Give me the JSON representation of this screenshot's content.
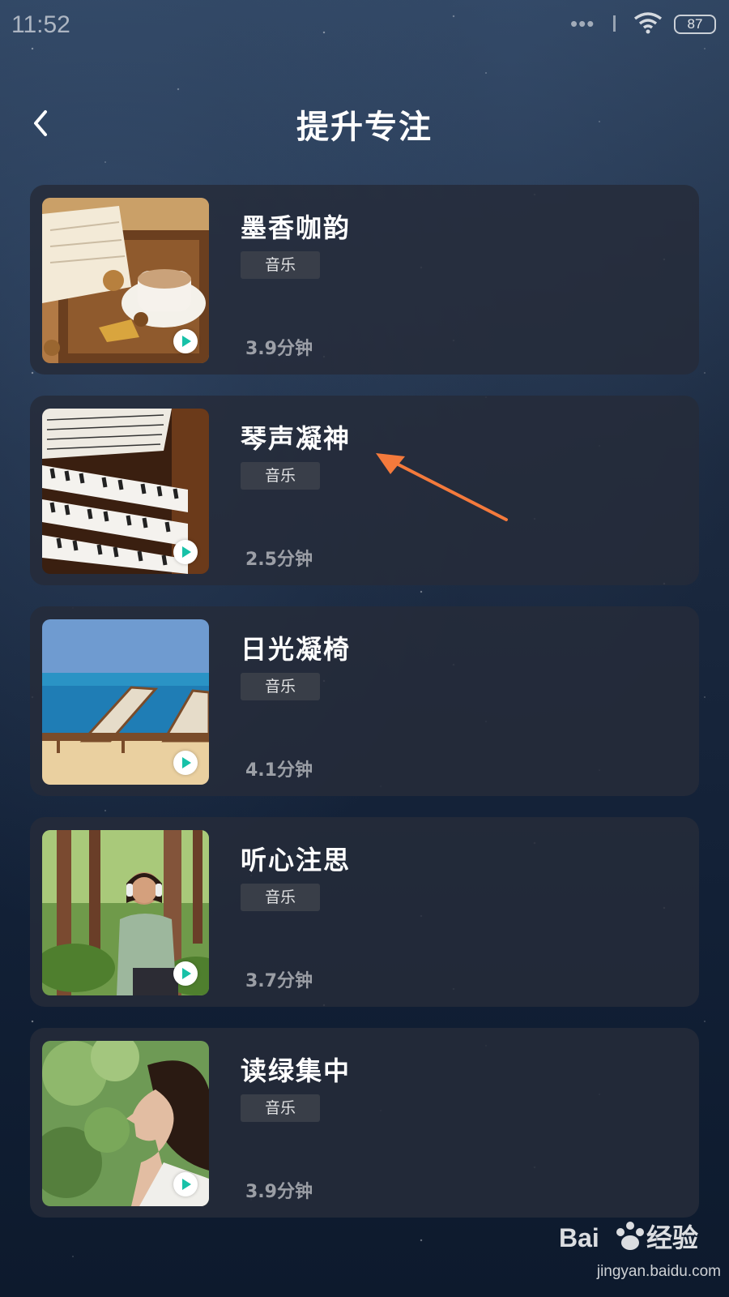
{
  "status_bar": {
    "time": "11:52",
    "dots": "•••",
    "battery": "87"
  },
  "header": {
    "title": "提升专注"
  },
  "items": [
    {
      "title": "墨香咖韵",
      "tag": "音乐",
      "duration": "3.9分钟",
      "thumbnail": "book-coffee-image"
    },
    {
      "title": "琴声凝神",
      "tag": "音乐",
      "duration": "2.5分钟",
      "thumbnail": "organ-keys-image"
    },
    {
      "title": "日光凝椅",
      "tag": "音乐",
      "duration": "4.1分钟",
      "thumbnail": "beach-chairs-image"
    },
    {
      "title": "听心注思",
      "tag": "音乐",
      "duration": "3.7分钟",
      "thumbnail": "forest-headphones-image"
    },
    {
      "title": "读绿集中",
      "tag": "音乐",
      "duration": "3.9分钟",
      "thumbnail": "woman-greenery-image"
    }
  ],
  "colors": {
    "play_accent": "#17c1a8",
    "annotation_arrow": "#f47a3c"
  },
  "watermark": {
    "brand": "Bai du 经验",
    "url": "jingyan.baidu.com"
  }
}
